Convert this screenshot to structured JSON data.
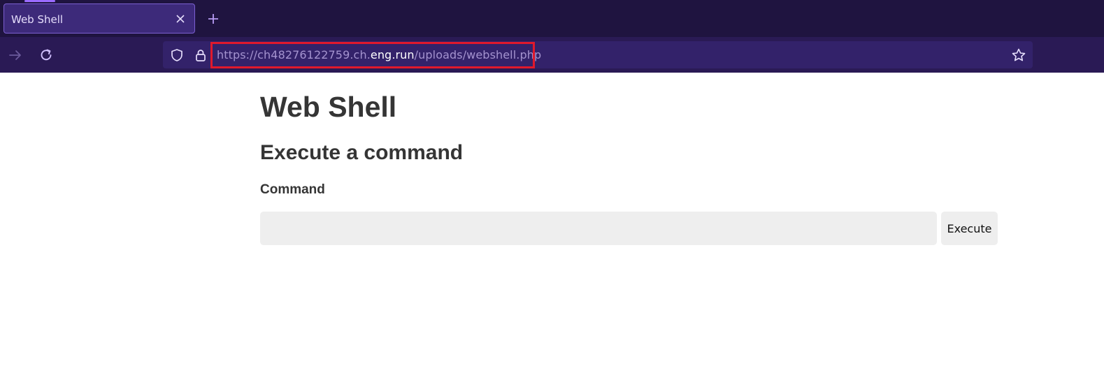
{
  "browser": {
    "tab": {
      "title": "Web Shell"
    },
    "address_bar": {
      "url_prefix": "https://ch48276122759.ch.",
      "url_host": "eng.run",
      "url_path": "/uploads/webshell.php"
    },
    "colors": {
      "tabbar_bg": "#1f1440",
      "navbar_bg": "#2a1a55",
      "highlight_box": "#e0192c"
    }
  },
  "page": {
    "title": "Web Shell",
    "section_title": "Execute a command",
    "command_label": "Command",
    "command_value": "",
    "execute_label": "Execute"
  }
}
